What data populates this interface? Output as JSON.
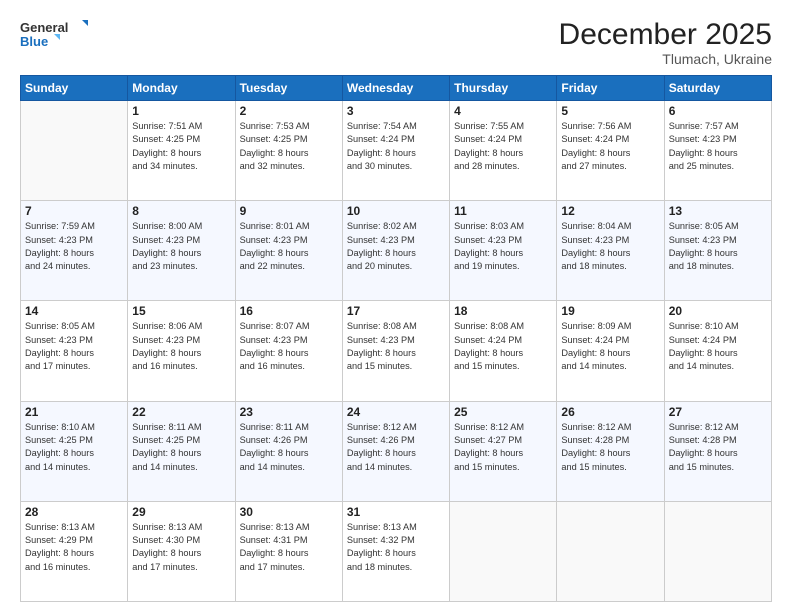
{
  "header": {
    "logo_line1": "General",
    "logo_line2": "Blue",
    "month": "December 2025",
    "location": "Tlumach, Ukraine"
  },
  "weekdays": [
    "Sunday",
    "Monday",
    "Tuesday",
    "Wednesday",
    "Thursday",
    "Friday",
    "Saturday"
  ],
  "weeks": [
    [
      {
        "day": "",
        "info": ""
      },
      {
        "day": "1",
        "info": "Sunrise: 7:51 AM\nSunset: 4:25 PM\nDaylight: 8 hours\nand 34 minutes."
      },
      {
        "day": "2",
        "info": "Sunrise: 7:53 AM\nSunset: 4:25 PM\nDaylight: 8 hours\nand 32 minutes."
      },
      {
        "day": "3",
        "info": "Sunrise: 7:54 AM\nSunset: 4:24 PM\nDaylight: 8 hours\nand 30 minutes."
      },
      {
        "day": "4",
        "info": "Sunrise: 7:55 AM\nSunset: 4:24 PM\nDaylight: 8 hours\nand 28 minutes."
      },
      {
        "day": "5",
        "info": "Sunrise: 7:56 AM\nSunset: 4:24 PM\nDaylight: 8 hours\nand 27 minutes."
      },
      {
        "day": "6",
        "info": "Sunrise: 7:57 AM\nSunset: 4:23 PM\nDaylight: 8 hours\nand 25 minutes."
      }
    ],
    [
      {
        "day": "7",
        "info": "Sunrise: 7:59 AM\nSunset: 4:23 PM\nDaylight: 8 hours\nand 24 minutes."
      },
      {
        "day": "8",
        "info": "Sunrise: 8:00 AM\nSunset: 4:23 PM\nDaylight: 8 hours\nand 23 minutes."
      },
      {
        "day": "9",
        "info": "Sunrise: 8:01 AM\nSunset: 4:23 PM\nDaylight: 8 hours\nand 22 minutes."
      },
      {
        "day": "10",
        "info": "Sunrise: 8:02 AM\nSunset: 4:23 PM\nDaylight: 8 hours\nand 20 minutes."
      },
      {
        "day": "11",
        "info": "Sunrise: 8:03 AM\nSunset: 4:23 PM\nDaylight: 8 hours\nand 19 minutes."
      },
      {
        "day": "12",
        "info": "Sunrise: 8:04 AM\nSunset: 4:23 PM\nDaylight: 8 hours\nand 18 minutes."
      },
      {
        "day": "13",
        "info": "Sunrise: 8:05 AM\nSunset: 4:23 PM\nDaylight: 8 hours\nand 18 minutes."
      }
    ],
    [
      {
        "day": "14",
        "info": "Sunrise: 8:05 AM\nSunset: 4:23 PM\nDaylight: 8 hours\nand 17 minutes."
      },
      {
        "day": "15",
        "info": "Sunrise: 8:06 AM\nSunset: 4:23 PM\nDaylight: 8 hours\nand 16 minutes."
      },
      {
        "day": "16",
        "info": "Sunrise: 8:07 AM\nSunset: 4:23 PM\nDaylight: 8 hours\nand 16 minutes."
      },
      {
        "day": "17",
        "info": "Sunrise: 8:08 AM\nSunset: 4:23 PM\nDaylight: 8 hours\nand 15 minutes."
      },
      {
        "day": "18",
        "info": "Sunrise: 8:08 AM\nSunset: 4:24 PM\nDaylight: 8 hours\nand 15 minutes."
      },
      {
        "day": "19",
        "info": "Sunrise: 8:09 AM\nSunset: 4:24 PM\nDaylight: 8 hours\nand 14 minutes."
      },
      {
        "day": "20",
        "info": "Sunrise: 8:10 AM\nSunset: 4:24 PM\nDaylight: 8 hours\nand 14 minutes."
      }
    ],
    [
      {
        "day": "21",
        "info": "Sunrise: 8:10 AM\nSunset: 4:25 PM\nDaylight: 8 hours\nand 14 minutes."
      },
      {
        "day": "22",
        "info": "Sunrise: 8:11 AM\nSunset: 4:25 PM\nDaylight: 8 hours\nand 14 minutes."
      },
      {
        "day": "23",
        "info": "Sunrise: 8:11 AM\nSunset: 4:26 PM\nDaylight: 8 hours\nand 14 minutes."
      },
      {
        "day": "24",
        "info": "Sunrise: 8:12 AM\nSunset: 4:26 PM\nDaylight: 8 hours\nand 14 minutes."
      },
      {
        "day": "25",
        "info": "Sunrise: 8:12 AM\nSunset: 4:27 PM\nDaylight: 8 hours\nand 15 minutes."
      },
      {
        "day": "26",
        "info": "Sunrise: 8:12 AM\nSunset: 4:28 PM\nDaylight: 8 hours\nand 15 minutes."
      },
      {
        "day": "27",
        "info": "Sunrise: 8:12 AM\nSunset: 4:28 PM\nDaylight: 8 hours\nand 15 minutes."
      }
    ],
    [
      {
        "day": "28",
        "info": "Sunrise: 8:13 AM\nSunset: 4:29 PM\nDaylight: 8 hours\nand 16 minutes."
      },
      {
        "day": "29",
        "info": "Sunrise: 8:13 AM\nSunset: 4:30 PM\nDaylight: 8 hours\nand 17 minutes."
      },
      {
        "day": "30",
        "info": "Sunrise: 8:13 AM\nSunset: 4:31 PM\nDaylight: 8 hours\nand 17 minutes."
      },
      {
        "day": "31",
        "info": "Sunrise: 8:13 AM\nSunset: 4:32 PM\nDaylight: 8 hours\nand 18 minutes."
      },
      {
        "day": "",
        "info": ""
      },
      {
        "day": "",
        "info": ""
      },
      {
        "day": "",
        "info": ""
      }
    ]
  ]
}
